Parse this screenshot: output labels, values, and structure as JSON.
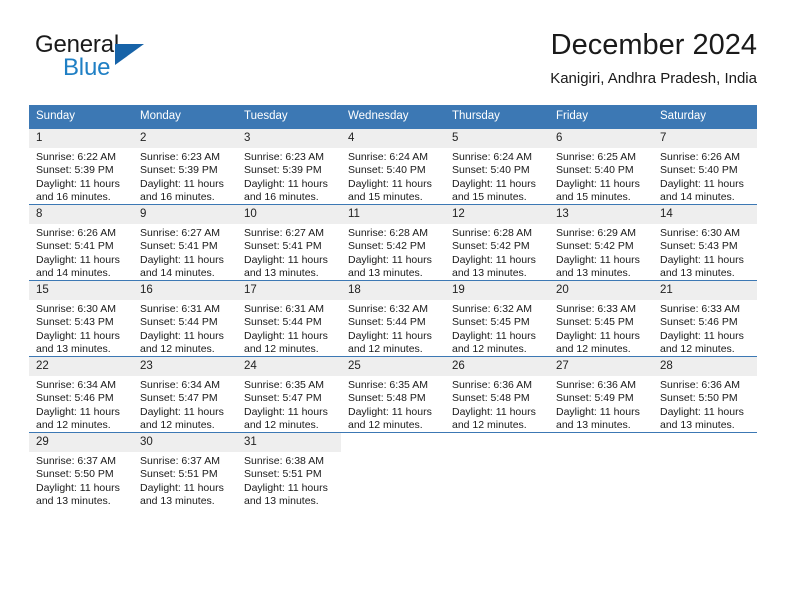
{
  "brand": {
    "word_one": "General",
    "word_two": "Blue",
    "triangle_icon": "triangle-icon",
    "colors": {
      "dark": "#1a1a1a",
      "blue": "#1f7fc4",
      "triangle": "#1763a8"
    }
  },
  "header": {
    "month_title": "December 2024",
    "location": "Kanigiri, Andhra Pradesh, India"
  },
  "theme": {
    "header_blue": "#3c78b4",
    "daynum_band": "#eeeeee",
    "cell_background": "#ffffff",
    "text": "#1a1a1a"
  },
  "weekday_headers": [
    "Sunday",
    "Monday",
    "Tuesday",
    "Wednesday",
    "Thursday",
    "Friday",
    "Saturday"
  ],
  "weeks": [
    [
      {
        "day": "1",
        "sunrise": "Sunrise: 6:22 AM",
        "sunset": "Sunset: 5:39 PM",
        "daylight_line1": "Daylight: 11 hours",
        "daylight_line2": "and 16 minutes."
      },
      {
        "day": "2",
        "sunrise": "Sunrise: 6:23 AM",
        "sunset": "Sunset: 5:39 PM",
        "daylight_line1": "Daylight: 11 hours",
        "daylight_line2": "and 16 minutes."
      },
      {
        "day": "3",
        "sunrise": "Sunrise: 6:23 AM",
        "sunset": "Sunset: 5:39 PM",
        "daylight_line1": "Daylight: 11 hours",
        "daylight_line2": "and 16 minutes."
      },
      {
        "day": "4",
        "sunrise": "Sunrise: 6:24 AM",
        "sunset": "Sunset: 5:40 PM",
        "daylight_line1": "Daylight: 11 hours",
        "daylight_line2": "and 15 minutes."
      },
      {
        "day": "5",
        "sunrise": "Sunrise: 6:24 AM",
        "sunset": "Sunset: 5:40 PM",
        "daylight_line1": "Daylight: 11 hours",
        "daylight_line2": "and 15 minutes."
      },
      {
        "day": "6",
        "sunrise": "Sunrise: 6:25 AM",
        "sunset": "Sunset: 5:40 PM",
        "daylight_line1": "Daylight: 11 hours",
        "daylight_line2": "and 15 minutes."
      },
      {
        "day": "7",
        "sunrise": "Sunrise: 6:26 AM",
        "sunset": "Sunset: 5:40 PM",
        "daylight_line1": "Daylight: 11 hours",
        "daylight_line2": "and 14 minutes."
      }
    ],
    [
      {
        "day": "8",
        "sunrise": "Sunrise: 6:26 AM",
        "sunset": "Sunset: 5:41 PM",
        "daylight_line1": "Daylight: 11 hours",
        "daylight_line2": "and 14 minutes."
      },
      {
        "day": "9",
        "sunrise": "Sunrise: 6:27 AM",
        "sunset": "Sunset: 5:41 PM",
        "daylight_line1": "Daylight: 11 hours",
        "daylight_line2": "and 14 minutes."
      },
      {
        "day": "10",
        "sunrise": "Sunrise: 6:27 AM",
        "sunset": "Sunset: 5:41 PM",
        "daylight_line1": "Daylight: 11 hours",
        "daylight_line2": "and 13 minutes."
      },
      {
        "day": "11",
        "sunrise": "Sunrise: 6:28 AM",
        "sunset": "Sunset: 5:42 PM",
        "daylight_line1": "Daylight: 11 hours",
        "daylight_line2": "and 13 minutes."
      },
      {
        "day": "12",
        "sunrise": "Sunrise: 6:28 AM",
        "sunset": "Sunset: 5:42 PM",
        "daylight_line1": "Daylight: 11 hours",
        "daylight_line2": "and 13 minutes."
      },
      {
        "day": "13",
        "sunrise": "Sunrise: 6:29 AM",
        "sunset": "Sunset: 5:42 PM",
        "daylight_line1": "Daylight: 11 hours",
        "daylight_line2": "and 13 minutes."
      },
      {
        "day": "14",
        "sunrise": "Sunrise: 6:30 AM",
        "sunset": "Sunset: 5:43 PM",
        "daylight_line1": "Daylight: 11 hours",
        "daylight_line2": "and 13 minutes."
      }
    ],
    [
      {
        "day": "15",
        "sunrise": "Sunrise: 6:30 AM",
        "sunset": "Sunset: 5:43 PM",
        "daylight_line1": "Daylight: 11 hours",
        "daylight_line2": "and 13 minutes."
      },
      {
        "day": "16",
        "sunrise": "Sunrise: 6:31 AM",
        "sunset": "Sunset: 5:44 PM",
        "daylight_line1": "Daylight: 11 hours",
        "daylight_line2": "and 12 minutes."
      },
      {
        "day": "17",
        "sunrise": "Sunrise: 6:31 AM",
        "sunset": "Sunset: 5:44 PM",
        "daylight_line1": "Daylight: 11 hours",
        "daylight_line2": "and 12 minutes."
      },
      {
        "day": "18",
        "sunrise": "Sunrise: 6:32 AM",
        "sunset": "Sunset: 5:44 PM",
        "daylight_line1": "Daylight: 11 hours",
        "daylight_line2": "and 12 minutes."
      },
      {
        "day": "19",
        "sunrise": "Sunrise: 6:32 AM",
        "sunset": "Sunset: 5:45 PM",
        "daylight_line1": "Daylight: 11 hours",
        "daylight_line2": "and 12 minutes."
      },
      {
        "day": "20",
        "sunrise": "Sunrise: 6:33 AM",
        "sunset": "Sunset: 5:45 PM",
        "daylight_line1": "Daylight: 11 hours",
        "daylight_line2": "and 12 minutes."
      },
      {
        "day": "21",
        "sunrise": "Sunrise: 6:33 AM",
        "sunset": "Sunset: 5:46 PM",
        "daylight_line1": "Daylight: 11 hours",
        "daylight_line2": "and 12 minutes."
      }
    ],
    [
      {
        "day": "22",
        "sunrise": "Sunrise: 6:34 AM",
        "sunset": "Sunset: 5:46 PM",
        "daylight_line1": "Daylight: 11 hours",
        "daylight_line2": "and 12 minutes."
      },
      {
        "day": "23",
        "sunrise": "Sunrise: 6:34 AM",
        "sunset": "Sunset: 5:47 PM",
        "daylight_line1": "Daylight: 11 hours",
        "daylight_line2": "and 12 minutes."
      },
      {
        "day": "24",
        "sunrise": "Sunrise: 6:35 AM",
        "sunset": "Sunset: 5:47 PM",
        "daylight_line1": "Daylight: 11 hours",
        "daylight_line2": "and 12 minutes."
      },
      {
        "day": "25",
        "sunrise": "Sunrise: 6:35 AM",
        "sunset": "Sunset: 5:48 PM",
        "daylight_line1": "Daylight: 11 hours",
        "daylight_line2": "and 12 minutes."
      },
      {
        "day": "26",
        "sunrise": "Sunrise: 6:36 AM",
        "sunset": "Sunset: 5:48 PM",
        "daylight_line1": "Daylight: 11 hours",
        "daylight_line2": "and 12 minutes."
      },
      {
        "day": "27",
        "sunrise": "Sunrise: 6:36 AM",
        "sunset": "Sunset: 5:49 PM",
        "daylight_line1": "Daylight: 11 hours",
        "daylight_line2": "and 13 minutes."
      },
      {
        "day": "28",
        "sunrise": "Sunrise: 6:36 AM",
        "sunset": "Sunset: 5:50 PM",
        "daylight_line1": "Daylight: 11 hours",
        "daylight_line2": "and 13 minutes."
      }
    ],
    [
      {
        "day": "29",
        "sunrise": "Sunrise: 6:37 AM",
        "sunset": "Sunset: 5:50 PM",
        "daylight_line1": "Daylight: 11 hours",
        "daylight_line2": "and 13 minutes."
      },
      {
        "day": "30",
        "sunrise": "Sunrise: 6:37 AM",
        "sunset": "Sunset: 5:51 PM",
        "daylight_line1": "Daylight: 11 hours",
        "daylight_line2": "and 13 minutes."
      },
      {
        "day": "31",
        "sunrise": "Sunrise: 6:38 AM",
        "sunset": "Sunset: 5:51 PM",
        "daylight_line1": "Daylight: 11 hours",
        "daylight_line2": "and 13 minutes."
      },
      null,
      null,
      null,
      null
    ]
  ]
}
